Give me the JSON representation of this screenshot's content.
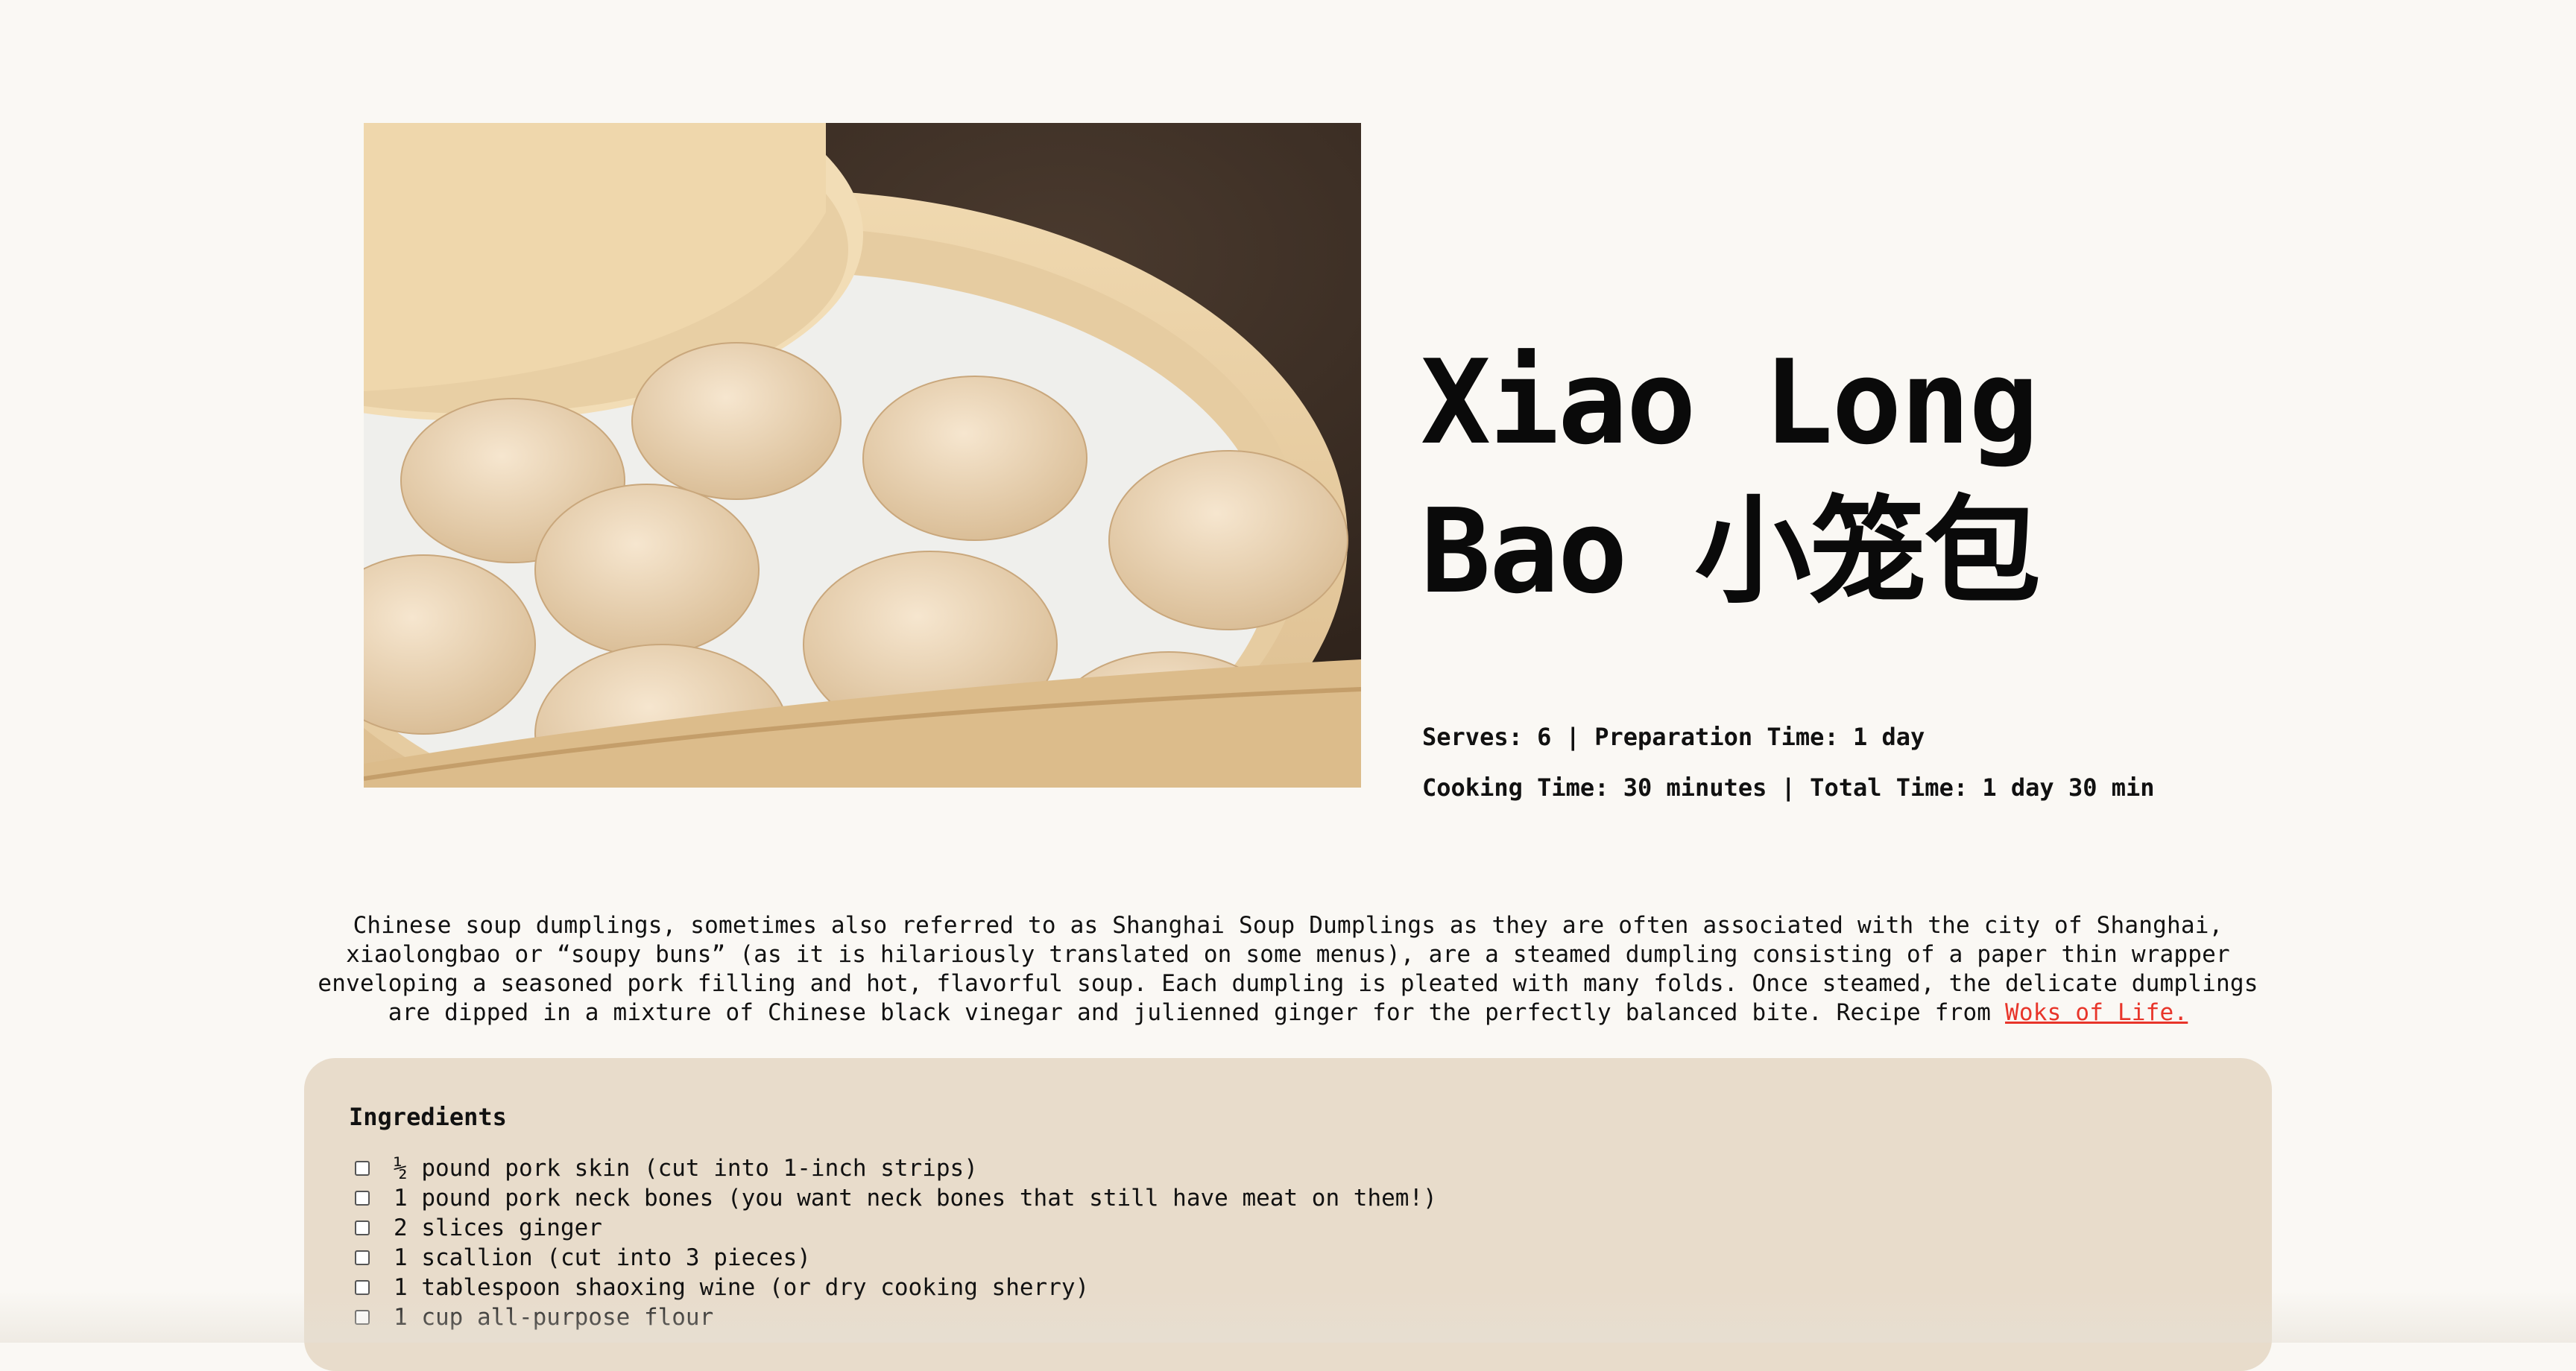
{
  "recipe": {
    "title_line1": "Xiao Long",
    "title_line2": "Bao 小笼包",
    "meta_line1": "Serves: 6 | Preparation Time: 1 day",
    "meta_line2": "Cooking Time: 30 minutes | Total Time: 1 day 30 min",
    "intro": "Chinese soup dumplings, sometimes also referred to as Shanghai Soup Dumplings as they are often associated with the city of Shanghai, xiaolongbao or “soupy buns” (as it is hilariously translated on some menus), are a steamed dumpling consisting of a paper thin wrapper enveloping a seasoned pork filling and hot, flavorful soup. Each dumpling is pleated with many folds. Once steamed, the delicate dumplings are dipped in a mixture of Chinese black vinegar and julienned ginger for the perfectly balanced bite. Recipe from ",
    "source_link": "Woks of Life."
  },
  "ingredients": {
    "heading": "Ingredients",
    "items": [
      "½ pound pork skin (cut into 1-inch strips)",
      "1 pound pork neck bones (you want neck bones that still have meat on them!)",
      "2 slices ginger",
      "1 scallion (cut into 3 pieces)",
      "1 tablespoon shaoxing wine (or dry cooking sherry)",
      "1 cup all-purpose flour"
    ]
  },
  "colors": {
    "background": "#faf8f4",
    "card": "#e8dccb",
    "link": "#e8352a"
  }
}
